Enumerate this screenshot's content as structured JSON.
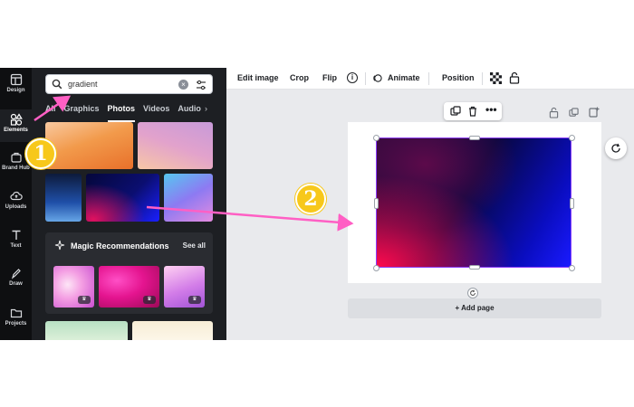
{
  "rail": {
    "items": [
      {
        "label": "Design",
        "icon": "layout-icon"
      },
      {
        "label": "Elements",
        "icon": "shapes-icon"
      },
      {
        "label": "Brand Hub",
        "icon": "brand-icon"
      },
      {
        "label": "Uploads",
        "icon": "cloud-upload-icon"
      },
      {
        "label": "Text",
        "icon": "text-icon"
      },
      {
        "label": "Draw",
        "icon": "pen-icon"
      },
      {
        "label": "Projects",
        "icon": "folder-icon"
      }
    ]
  },
  "search": {
    "value": "gradient"
  },
  "tabs": [
    "All",
    "Graphics",
    "Photos",
    "Videos",
    "Audio"
  ],
  "active_tab": "Photos",
  "magic": {
    "title": "Magic Recommendations",
    "see_all": "See all",
    "badge": "♛"
  },
  "toolbar": {
    "edit_image": "Edit image",
    "crop": "Crop",
    "flip": "Flip",
    "info": "i",
    "animate": "Animate",
    "position": "Position"
  },
  "canvas": {
    "add_page": "+ Add page"
  },
  "annotations": {
    "step1": "1",
    "step2": "2"
  },
  "colors": {
    "arrow": "#ff5fc4",
    "marker": "#f7c81b",
    "selection": "#8b3dff"
  }
}
